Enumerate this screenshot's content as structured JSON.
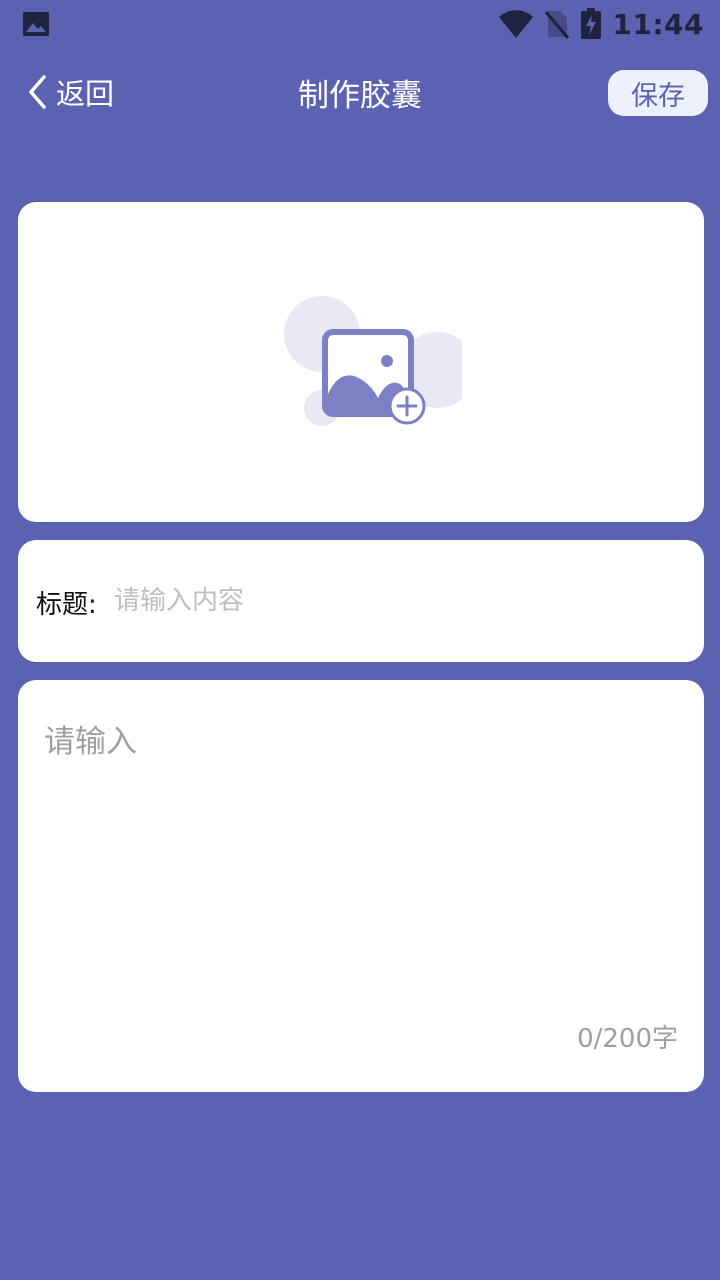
{
  "status_bar": {
    "time": "11:44",
    "icons": [
      "gallery-notification-icon",
      "wifi-icon",
      "no-sim-icon",
      "battery-charging-icon"
    ]
  },
  "header": {
    "back_label": "返回",
    "title": "制作胶囊",
    "save_label": "保存"
  },
  "image_upload": {
    "icon": "add-image-icon"
  },
  "title_field": {
    "label": "标题:",
    "placeholder": "请输入内容",
    "value": ""
  },
  "content_field": {
    "placeholder": "请输入",
    "value": "",
    "counter": "0/200字"
  },
  "colors": {
    "background": "#5c62b2",
    "card": "#ffffff",
    "save_button_bg": "#eef0fb",
    "accent": "#7c80c4"
  }
}
